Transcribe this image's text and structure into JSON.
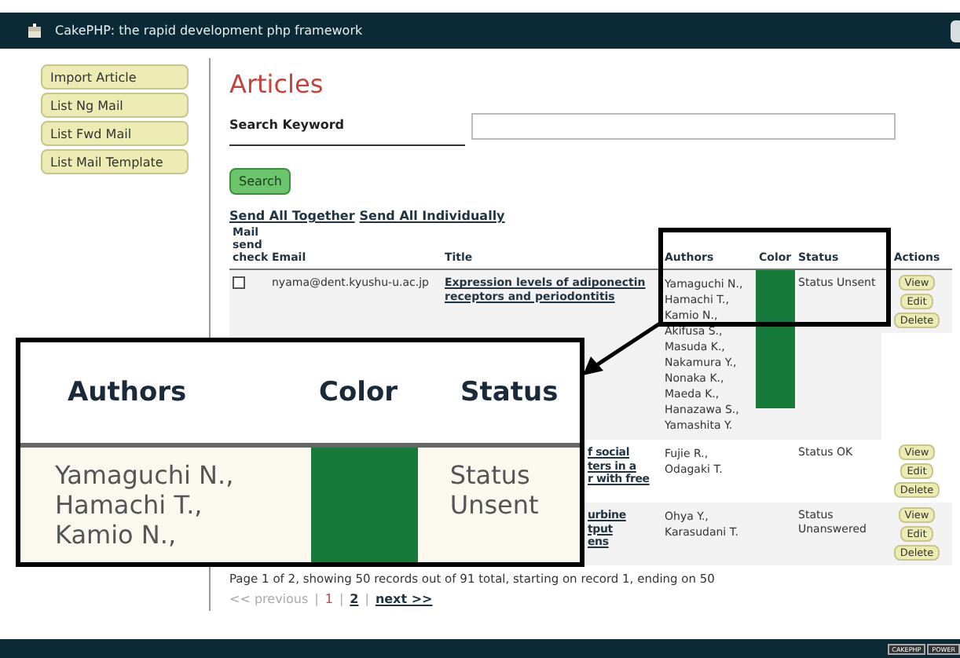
{
  "header": {
    "title": "CakePHP: the rapid development php framework"
  },
  "sidebar": {
    "items": [
      {
        "label": "Import Article"
      },
      {
        "label": "List Ng Mail"
      },
      {
        "label": "List Fwd Mail"
      },
      {
        "label": "List Mail Template"
      }
    ]
  },
  "page_title": "Articles",
  "search": {
    "label": "Search Keyword",
    "button": "Search"
  },
  "bulk_links": [
    "Send All Together",
    "Send All Individually"
  ],
  "table": {
    "columns": [
      "Mail send check",
      "Email",
      "Title",
      "Authors",
      "Color",
      "Status",
      "Actions"
    ],
    "rows": [
      {
        "kind": "full",
        "checked": false,
        "email": "nyama@dent.kyushu-u.ac.jp",
        "title": "Expression levels of adiponectin receptors and periodontitis",
        "authors": [
          "Yamaguchi N.,",
          "Hamachi T.,",
          "Kamio N.,",
          "Akifusa S.,",
          "Masuda K.,",
          "Nakamura Y.,",
          "Nonaka K.,",
          "Maeda K.,",
          "Hanazawa S.,",
          "Yamashita Y."
        ],
        "color": "#157a3a",
        "status": "Status Unsent",
        "actions": [
          "View",
          "Edit",
          "Delete"
        ]
      },
      {
        "kind": "partial",
        "title_fragments": [
          "f social",
          "ters in a",
          "r with free"
        ],
        "authors": [
          "Fujie R.,",
          "Odagaki T."
        ],
        "status": "Status OK",
        "actions": [
          "View",
          "Edit",
          "Delete"
        ]
      },
      {
        "kind": "partial",
        "title_fragments": [
          "urbine",
          "tput",
          "ens"
        ],
        "authors": [
          "Ohya Y.,",
          "Karasudani T."
        ],
        "status": "Status Unanswered",
        "actions": [
          "View",
          "Edit",
          "Delete"
        ]
      }
    ]
  },
  "callout": {
    "columns": [
      "Authors",
      "Color",
      "Status"
    ],
    "authors": "Yamaguchi N., Hamachi T., Kamio N.,",
    "color": "#157a3a",
    "status": "Status Unsent"
  },
  "pagination": {
    "summary": "Page 1 of 2, showing 50 records out of 91 total, starting on record 1, ending on 50",
    "previous": "<< previous",
    "separator": "|",
    "pages": [
      {
        "label": "1",
        "selected": true
      },
      {
        "label": "2",
        "selected": false
      }
    ],
    "next": "next >>"
  },
  "footer": {
    "badges": [
      "CAKEPHP",
      "POWER"
    ]
  }
}
